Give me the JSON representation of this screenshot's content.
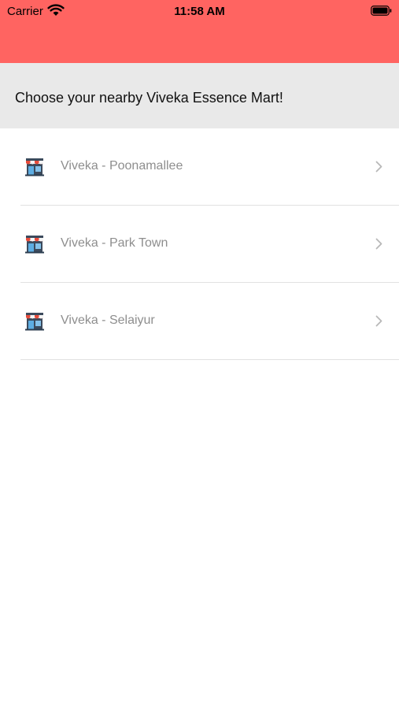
{
  "status_bar": {
    "carrier": "Carrier",
    "time": "11:58 AM",
    "color": "#FF6461"
  },
  "header": {
    "title": "Choose your nearby Viveka Essence Mart!"
  },
  "stores": [
    {
      "label": "Viveka - Poonamallee",
      "icon": "store-icon"
    },
    {
      "label": "Viveka - Park Town",
      "icon": "store-icon"
    },
    {
      "label": "Viveka - Selaiyur",
      "icon": "store-icon"
    }
  ]
}
